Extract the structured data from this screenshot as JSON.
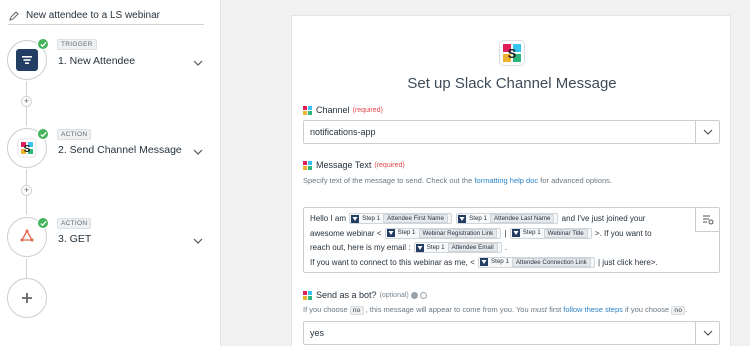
{
  "zap": {
    "title": "New attendee to a LS webinar"
  },
  "steps": [
    {
      "tag": "TRIGGER",
      "label": "1. New Attendee",
      "app_icon": "filter-list-icon"
    },
    {
      "tag": "ACTION",
      "label": "2. Send Channel Message",
      "app_icon": "slack-icon"
    },
    {
      "tag": "ACTION",
      "label": "3. GET",
      "app_icon": "webhook-icon"
    }
  ],
  "form": {
    "title": "Set up Slack Channel Message",
    "channel": {
      "label": "Channel",
      "required": "(required)",
      "value": "notifications-app"
    },
    "message": {
      "label": "Message Text",
      "required": "(required)",
      "help_prefix": "Specify text of the message to send. Check out the",
      "help_link": "formatting help doc",
      "help_suffix": "for advanced options.",
      "lines": {
        "l1_a": "Hello I am",
        "l1_b": "and I've just joined your",
        "l2_a": "awesome webinar <",
        "l2_b": "|",
        "l2_c": ">. If you want to",
        "l3_a": "reach out, here is my email :",
        "l3_b": ".",
        "l4_a": "If you want to connect to this webinar as me, <",
        "l4_b": "| just click here>."
      },
      "pills": {
        "first_name": {
          "step": "Step 1",
          "field": "Attendee First Name"
        },
        "last_name": {
          "step": "Step 1",
          "field": "Attendee Last Name"
        },
        "reg_link": {
          "step": "Step 1",
          "field": "Webinar Registration Link"
        },
        "webinar_title": {
          "step": "Step 1",
          "field": "Webinar Title"
        },
        "email": {
          "step": "Step 1",
          "field": "Attendee Email"
        },
        "conn_link": {
          "step": "Step 1",
          "field": "Attendee Connection Link"
        }
      }
    },
    "bot": {
      "label": "Send as a bot?",
      "optional": "(optional)",
      "help_1": "If you choose",
      "code_no": "no",
      "help_2": ", this message will appear to come from you. You",
      "help_must": "must",
      "help_3": "first",
      "help_link": "follow these steps",
      "help_4": "if you choose",
      "help_5": ".",
      "value": "yes"
    }
  },
  "colors": {
    "accent": "#2d83c6",
    "success": "#44b35a",
    "required": "#e0474b",
    "trigger_icon_bg": "#243e63"
  }
}
